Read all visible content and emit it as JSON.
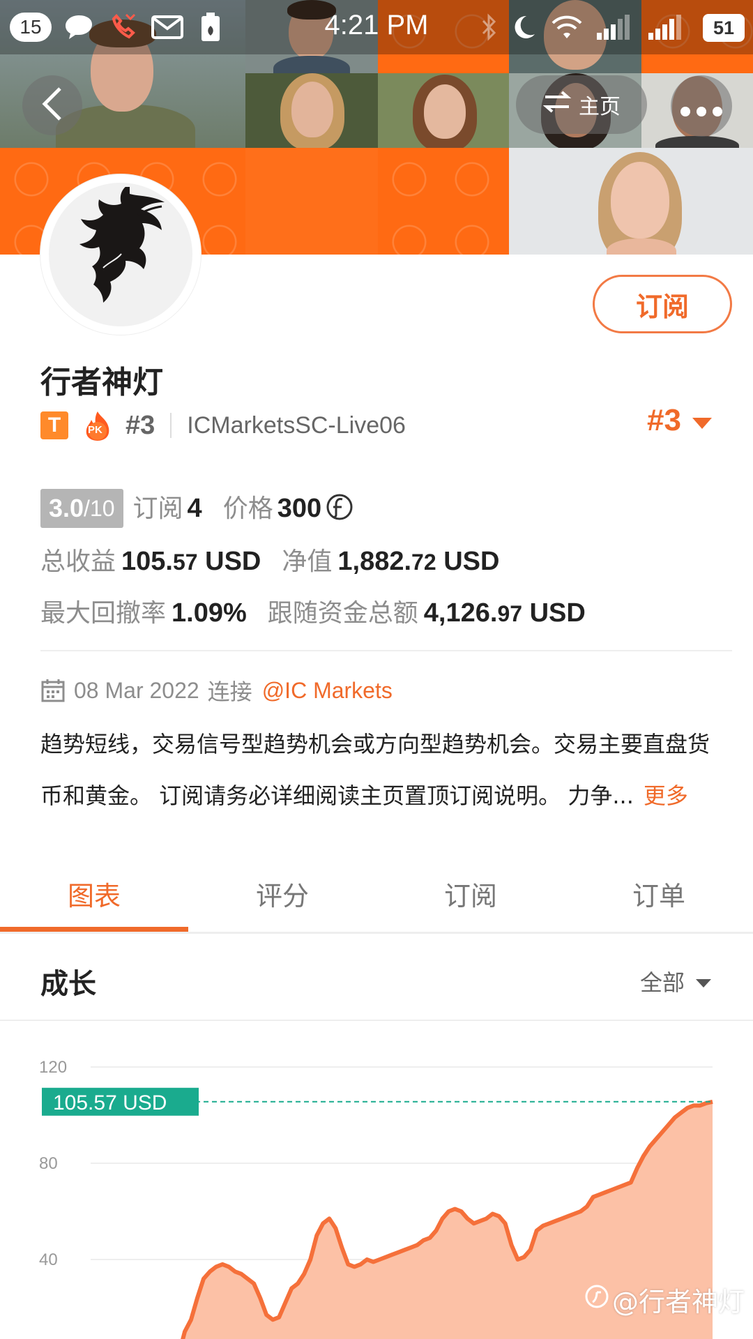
{
  "status_bar": {
    "notification_count": "15",
    "time": "4:21 PM",
    "battery": "51",
    "icons": [
      "chat-icon",
      "missed-call-icon",
      "mail-icon",
      "battery-saver-icon",
      "bluetooth-icon",
      "moon-icon",
      "wifi-icon",
      "signal-icon"
    ]
  },
  "header": {
    "home_label": "主页"
  },
  "profile": {
    "name": "行者神灯",
    "badge_t": "T",
    "badge_pk": "PK",
    "rank": "#3",
    "server": "ICMarketsSC-Live06",
    "rank_right": "#3",
    "subscribe_label": "订阅"
  },
  "stats": {
    "score_value": "3.0",
    "score_denominator": "/10",
    "subscribers_label": "订阅",
    "subscribers_value": "4",
    "price_label": "价格",
    "price_value": "300",
    "total_profit_label": "总收益",
    "total_profit_int": "105.",
    "total_profit_dec": "57",
    "total_profit_unit": " USD",
    "equity_label": "净值",
    "equity_int": "1,882.",
    "equity_dec": "72",
    "equity_unit": " USD",
    "max_drawdown_label": "最大回撤率",
    "max_drawdown_value": "1.09%",
    "follow_funds_label": "跟随资金总额",
    "follow_funds_int": "4,126.",
    "follow_funds_dec": "97",
    "follow_funds_unit": " USD"
  },
  "connection": {
    "date": "08 Mar 2022",
    "connect_label": "连接",
    "broker": "@IC Markets"
  },
  "description": {
    "line1": "趋势短线，交易信号型趋势机会或方向型趋势机会。交易主要直盘货",
    "line2": "币和黄金。 订阅请务必详细阅读主页置顶订阅说明。 力争...",
    "more_label": "更多"
  },
  "tabs": [
    {
      "label": "图表",
      "active": true
    },
    {
      "label": "评分",
      "active": false
    },
    {
      "label": "订阅",
      "active": false
    },
    {
      "label": "订单",
      "active": false
    }
  ],
  "growth": {
    "title": "成长",
    "range_label": "全部"
  },
  "chart_data": {
    "type": "area",
    "y_ticks": [
      "120",
      "80",
      "40"
    ],
    "ylim": [
      0,
      120
    ],
    "marker_label": "105.57 USD",
    "marker_value": 105.57,
    "x": [
      0,
      1,
      2,
      3,
      4,
      5,
      6,
      7,
      8,
      9,
      10,
      11,
      12,
      13,
      14,
      15,
      16,
      17,
      18,
      19,
      20,
      21,
      22,
      23,
      24,
      25,
      26,
      27,
      28,
      29,
      30,
      31,
      32,
      33,
      34,
      35,
      36,
      37,
      38,
      39,
      40,
      41,
      42,
      43,
      44,
      45,
      46,
      47,
      48,
      49,
      50,
      51,
      52,
      53,
      54,
      55,
      56,
      57,
      58,
      59,
      60,
      61,
      62,
      63,
      64,
      65,
      66,
      67,
      68,
      69,
      70,
      71,
      72,
      73,
      74,
      75,
      76,
      77,
      78,
      79,
      80,
      81,
      82,
      83,
      84,
      85,
      86,
      87,
      88,
      89,
      90,
      91,
      92,
      93,
      94,
      95,
      96,
      97,
      98,
      99,
      100,
      101,
      102,
      103,
      104,
      105,
      106,
      107,
      108,
      109,
      110,
      111,
      112,
      113,
      114,
      115,
      116,
      117,
      118,
      119,
      120,
      121,
      122,
      123,
      124,
      125,
      126,
      127,
      128,
      129,
      130,
      131,
      132,
      133,
      134,
      135,
      136,
      137,
      138,
      139
    ],
    "values": [
      0,
      10,
      15,
      24,
      32,
      35,
      37,
      38,
      37,
      35,
      34,
      32,
      30,
      24,
      17,
      15,
      16,
      22,
      28,
      30,
      34,
      40,
      50,
      55,
      57,
      53,
      45,
      38,
      37,
      38,
      40,
      39,
      40,
      41,
      42,
      43,
      44,
      45,
      46,
      48,
      49,
      52,
      57,
      60,
      61,
      60,
      57,
      55,
      56,
      57,
      59,
      58,
      55,
      46,
      40,
      41,
      44,
      52,
      54,
      55,
      56,
      57,
      58,
      59,
      60,
      62,
      66,
      67,
      68,
      69,
      70,
      71,
      72,
      78,
      83,
      87,
      90,
      93,
      96,
      99,
      101,
      103,
      104,
      104,
      105,
      105.57,
      0,
      0,
      0,
      0,
      0,
      0,
      0,
      0,
      0,
      0,
      0,
      0,
      0,
      0,
      0,
      0,
      0,
      0,
      0,
      0,
      0,
      0,
      0,
      0,
      0,
      0,
      0,
      0,
      0,
      0,
      0,
      0,
      0,
      0,
      0,
      0,
      0,
      0,
      0,
      0,
      0,
      0,
      0,
      0,
      0,
      0,
      0,
      0,
      0,
      0,
      0,
      0,
      0,
      0,
      0,
      0,
      0,
      0
    ],
    "colors": {
      "line": "#f5703a",
      "fill": "#fcc1a6",
      "marker": "#1aab8e",
      "grid": "#eeeeee"
    }
  },
  "watermark": {
    "text": "@行者神灯"
  }
}
